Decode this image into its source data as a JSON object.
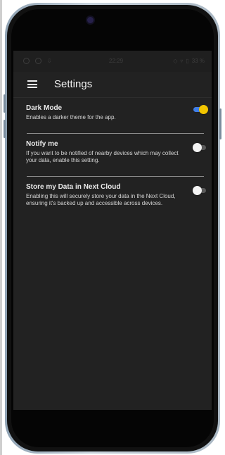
{
  "status_bar": {
    "time": "22:29",
    "battery": "33 %"
  },
  "app_bar": {
    "title": "Settings",
    "menu_icon": "hamburger-menu-icon"
  },
  "settings": [
    {
      "title": "Dark Mode",
      "description": "Enables a darker theme for the app.",
      "enabled": true
    },
    {
      "title": "Notify me",
      "description": "If you want to be notified of nearby devices which may collect your data, enable this setting.",
      "enabled": false
    },
    {
      "title": "Store my Data in Next Cloud",
      "description": "Enabling this will securely store your data in the Next Cloud, ensuring it's backed up and accessible across devices.",
      "enabled": false
    }
  ],
  "colors": {
    "screen_background": "#222222",
    "toggle_on_track": "#3f7ee8",
    "toggle_on_thumb": "#f2c500",
    "toggle_off_thumb": "#f4f4f4"
  }
}
